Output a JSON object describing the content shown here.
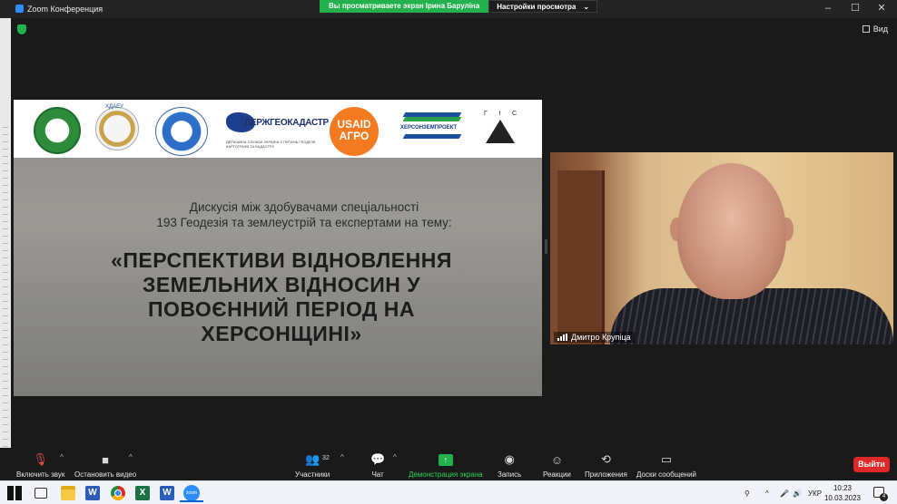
{
  "window": {
    "title": "Zoom Конференция",
    "share_banner": "Вы просматриваете экран Ірина Барулiна",
    "view_options": "Настройки просмотра",
    "view_options_caret": "⌄",
    "minimize": "–",
    "maximize": "☐",
    "close": "✕",
    "view_button": "Вид"
  },
  "slide": {
    "logos": {
      "usaid_line1": "USAID",
      "usaid_line2": "АГРО",
      "geokadastr": "ДЕРЖГЕОКАДАСТР",
      "geokadastr_sub": "ДЕРЖАВНА СЛУЖБА УКРАЇНИ З ПИТАНЬ ГЕОДЕЗІЇ, КАРТОГРАФІЇ ТА КАДАСТРУ",
      "khersonzem": "ХЕРСОНЗЕМПРОЕКТ",
      "gis_letters": [
        "Г",
        "І",
        "С"
      ],
      "kdaeu": "ХДАЕУ"
    },
    "intro_line1": "Дискусія між здобувачами спеціальності",
    "intro_line2": "193 Геодезія та землеустрій та експертами на тему:",
    "title": "«ПЕРСПЕКТИВИ ВІДНОВЛЕННЯ ЗЕМЕЛЬНИХ ВІДНОСИН У ПОВОЄННИЙ ПЕРІОД НА ХЕРСОНЩИНІ»"
  },
  "participant": {
    "name": "Дмитро Крупіца"
  },
  "toolbar": {
    "mute": "Включить звук",
    "video": "Остановить видео",
    "participants": "Участники",
    "participants_count": "32",
    "chat": "Чат",
    "share": "Демонстрация экрана",
    "record": "Запись",
    "reactions": "Реакции",
    "apps": "Приложения",
    "whiteboards": "Доски сообщений",
    "leave": "Выйти",
    "caret": "^"
  },
  "taskbar": {
    "word_letter": "W",
    "excel_letter": "X",
    "zoom_label": "zoom",
    "language": "УКР",
    "time": "10:23",
    "date": "10.03.2023",
    "notifications": "4"
  },
  "colors": {
    "zoom_blue": "#2d8cff",
    "share_green": "#23b14d",
    "leave_red": "#e02828",
    "usaid_orange": "#f47a20"
  }
}
